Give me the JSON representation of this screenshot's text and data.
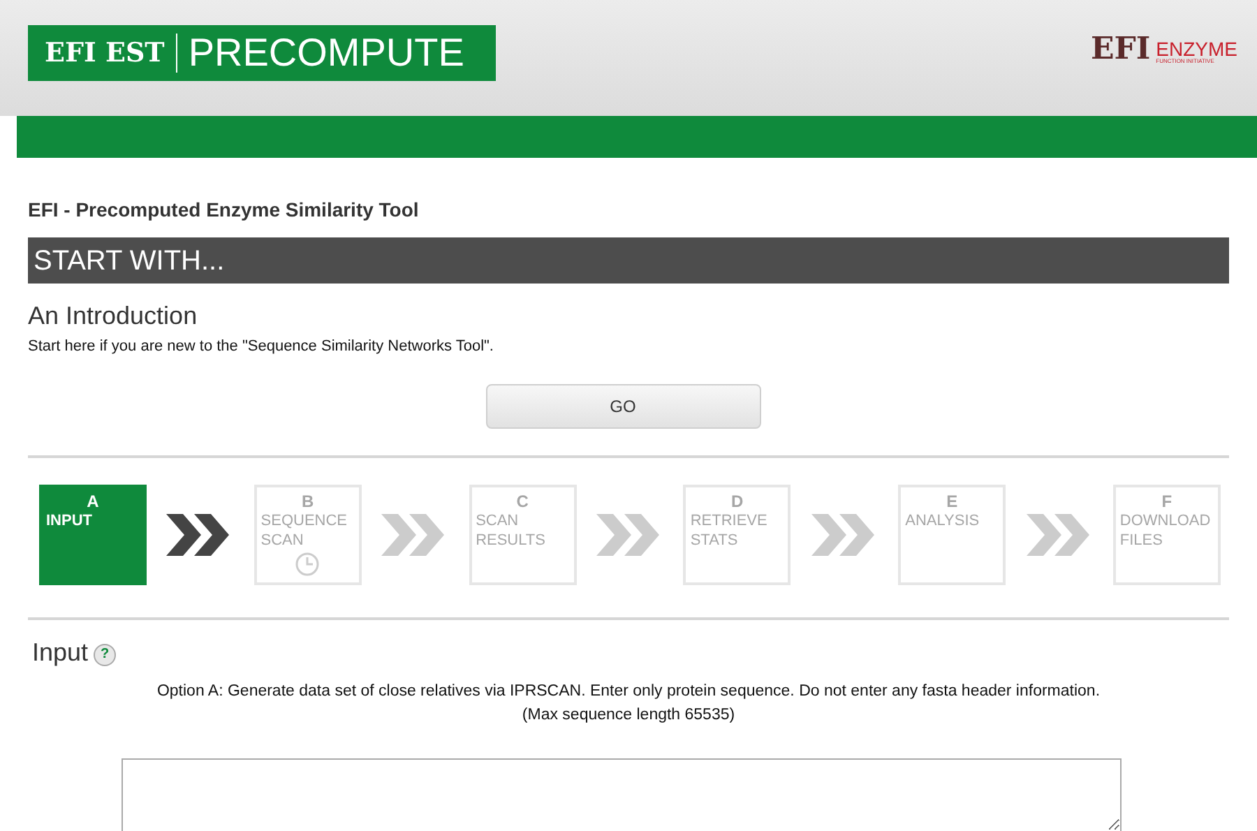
{
  "header": {
    "logo_left": {
      "mark": "EFI EST",
      "title": "PRECOMPUTE"
    },
    "logo_right": {
      "mark": "EFI",
      "name": "ENZYME",
      "tagline": "FUNCTION INITIATIVE"
    }
  },
  "page_title": "EFI - Precomputed Enzyme Similarity Tool",
  "section_bar": "START WITH...",
  "intro": {
    "heading": "An Introduction",
    "text": "Start here if you are new to the \"Sequence Similarity Networks Tool\".",
    "button": "GO"
  },
  "steps": [
    {
      "letter": "A",
      "label": "INPUT",
      "selected": true,
      "clock": false
    },
    {
      "letter": "B",
      "label": "SEQUENCE SCAN",
      "selected": false,
      "clock": true
    },
    {
      "letter": "C",
      "label": "SCAN RESULTS",
      "selected": false,
      "clock": false
    },
    {
      "letter": "D",
      "label": "RETRIEVE STATS",
      "selected": false,
      "clock": false
    },
    {
      "letter": "E",
      "label": "ANALYSIS",
      "selected": false,
      "clock": false
    },
    {
      "letter": "F",
      "label": "DOWNLOAD FILES",
      "selected": false,
      "clock": false
    }
  ],
  "input": {
    "heading": "Input",
    "help": "?",
    "option_text": "Option A: Generate data set of close relatives via IPRSCAN. Enter only protein sequence. Do not enter any fasta header information.",
    "limit_text": "(Max sequence length 65535)"
  }
}
